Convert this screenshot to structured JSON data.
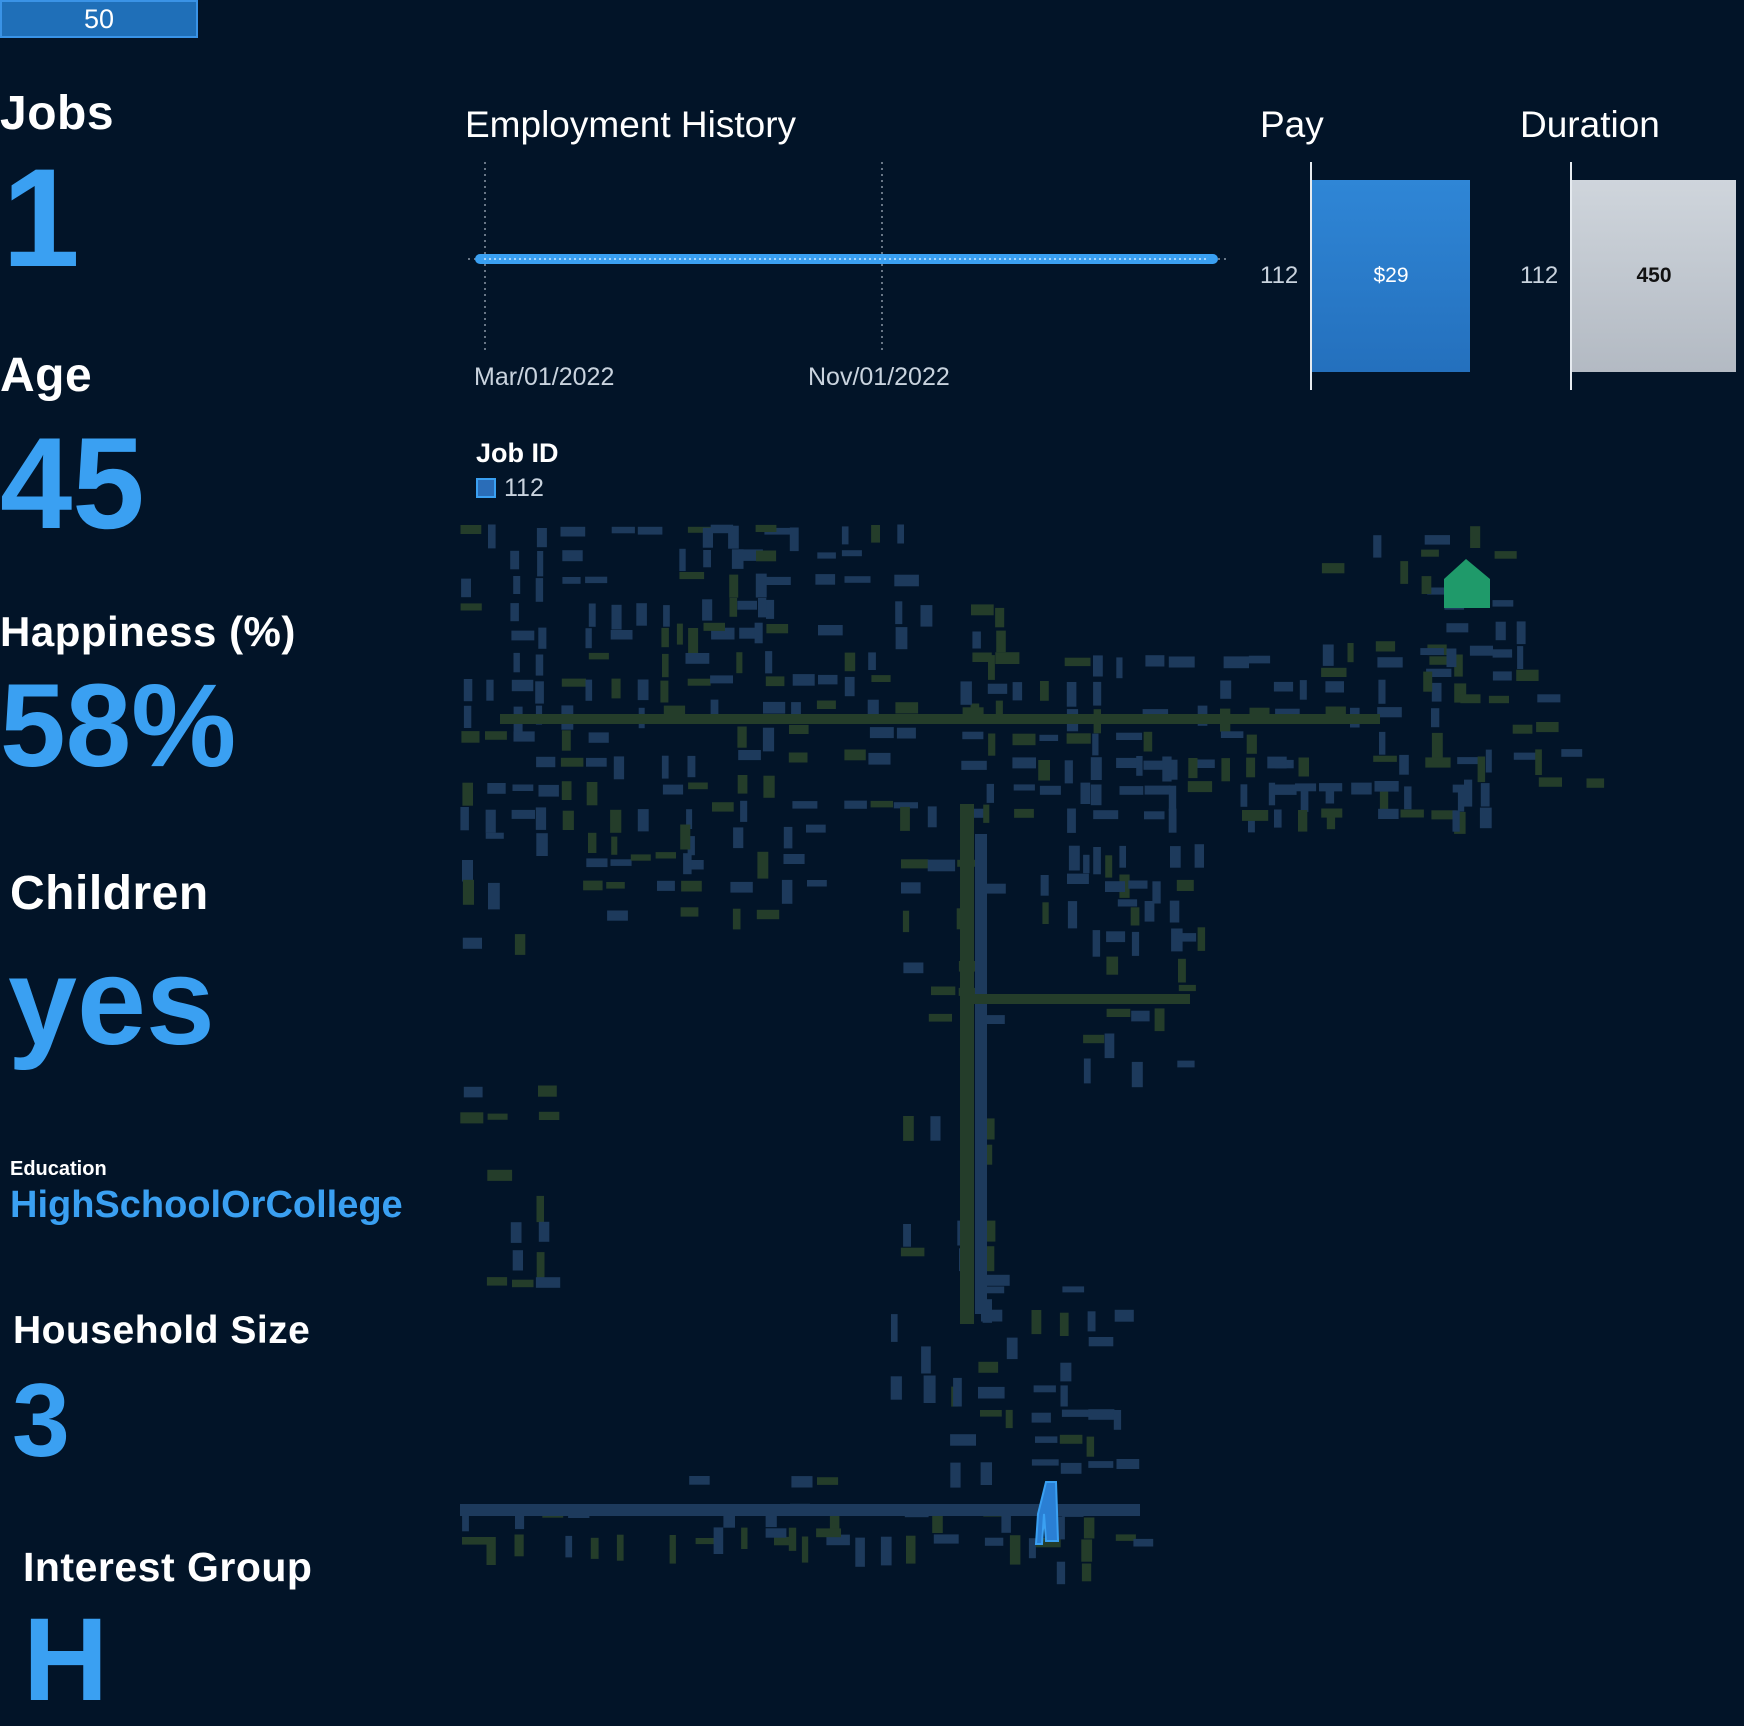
{
  "participant_selector": {
    "value": "50"
  },
  "stats": {
    "jobs": {
      "label": "Jobs",
      "value": "1"
    },
    "age": {
      "label": "Age",
      "value": "45"
    },
    "happiness": {
      "label": "Happiness (%)",
      "value": "58%"
    },
    "children": {
      "label": "Children",
      "value": "yes"
    },
    "education": {
      "label": "Education",
      "value": "HighSchoolOrCollege"
    },
    "household": {
      "label": "Household Size",
      "value": "3"
    },
    "interest": {
      "label": "Interest Group",
      "value": "H"
    }
  },
  "employment_history": {
    "title": "Employment History",
    "tick_labels": [
      "Mar/01/2022",
      "Nov/01/2022"
    ]
  },
  "pay": {
    "title": "Pay",
    "job_id": "112",
    "value_label": "$29"
  },
  "duration": {
    "title": "Duration",
    "job_id": "112",
    "value_label": "450"
  },
  "legend": {
    "title": "Job ID",
    "items": [
      {
        "label": "112",
        "color": "#2a7fd4"
      }
    ]
  },
  "colors": {
    "background": "#021428",
    "accent": "#3aa0f2",
    "job_blue": "#2a7fd4",
    "duration_gray": "#c6ccd4",
    "building_residential": "#1d3a5c",
    "building_commercial": "#243d2a",
    "home_marker": "#1f9a6a"
  },
  "map": {
    "home_icon": "home-marker-icon",
    "workplace_icon": "workplace-marker"
  },
  "chart_data": [
    {
      "type": "line",
      "title": "Employment History",
      "x": [
        "Mar/01/2022",
        "Nov/01/2022"
      ],
      "series": [
        {
          "name": "112",
          "x_range": [
            "2022-03-01",
            "2023-05-25"
          ]
        }
      ]
    },
    {
      "type": "bar",
      "title": "Pay",
      "categories": [
        "112"
      ],
      "values": [
        29
      ],
      "data_labels": [
        "$29"
      ]
    },
    {
      "type": "bar",
      "title": "Duration",
      "categories": [
        "112"
      ],
      "values": [
        450
      ],
      "data_labels": [
        "450"
      ]
    }
  ]
}
